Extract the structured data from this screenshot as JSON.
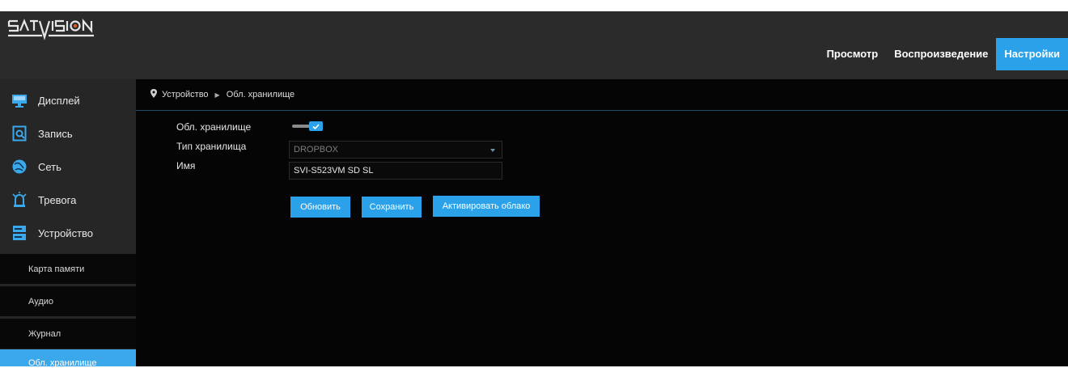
{
  "brand": {
    "logo_text": "SATVISION",
    "accent_color": "#2aa1e8"
  },
  "nav": {
    "tabs": [
      {
        "label": "Просмотр",
        "active": false
      },
      {
        "label": "Воспроизведение",
        "active": false
      },
      {
        "label": "Настройки",
        "active": true
      }
    ]
  },
  "sidebar": {
    "items": [
      {
        "label": "Дисплей",
        "icon": "monitor-icon"
      },
      {
        "label": "Запись",
        "icon": "record-icon"
      },
      {
        "label": "Сеть",
        "icon": "network-icon"
      },
      {
        "label": "Тревога",
        "icon": "alarm-icon"
      },
      {
        "label": "Устройство",
        "icon": "device-icon"
      }
    ],
    "subitems": [
      {
        "label": "Карта памяти",
        "active": false
      },
      {
        "label": "Аудио",
        "active": false
      },
      {
        "label": "Журнал",
        "active": false
      },
      {
        "label": "Обл. хранилище",
        "active": true
      }
    ]
  },
  "breadcrumb": {
    "parent": "Устройство",
    "current": "Обл. хранилище"
  },
  "form": {
    "cloud_label": "Обл. хранилище",
    "cloud_enabled": true,
    "type_label": "Тип хранилища",
    "type_value": "DROPBOX",
    "name_label": "Имя",
    "name_value": "SVI-S523VM SD SL"
  },
  "buttons": {
    "refresh": "Обновить",
    "save": "Сохранить",
    "activate": "Активировать облако"
  }
}
